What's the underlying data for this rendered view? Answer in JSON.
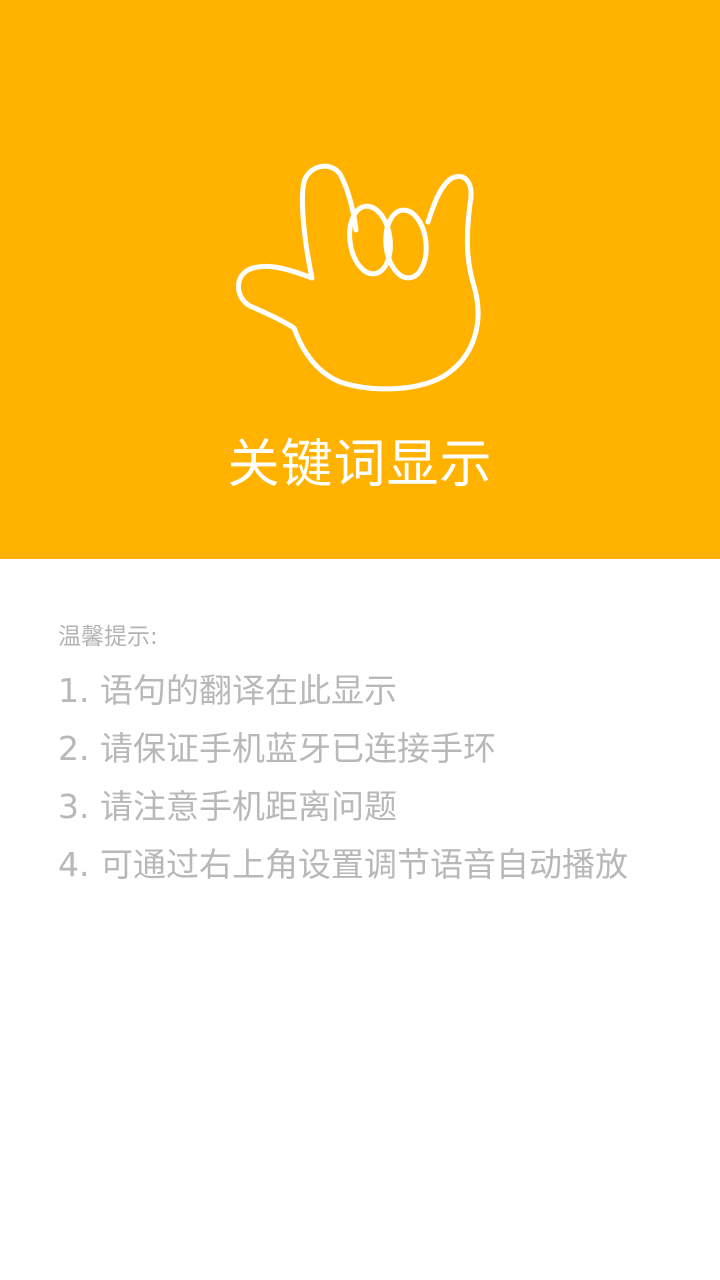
{
  "header": {
    "icon": "hand-gesture-icon",
    "title": "关键词显示",
    "background_color": "#FFB300"
  },
  "tips": {
    "heading": "温馨提示:",
    "items": [
      "1. 语句的翻译在此显示",
      "2. 请保证手机蓝牙已连接手环",
      "3. 请注意手机距离问题",
      "4. 可通过右上角设置调节语音自动播放"
    ]
  }
}
